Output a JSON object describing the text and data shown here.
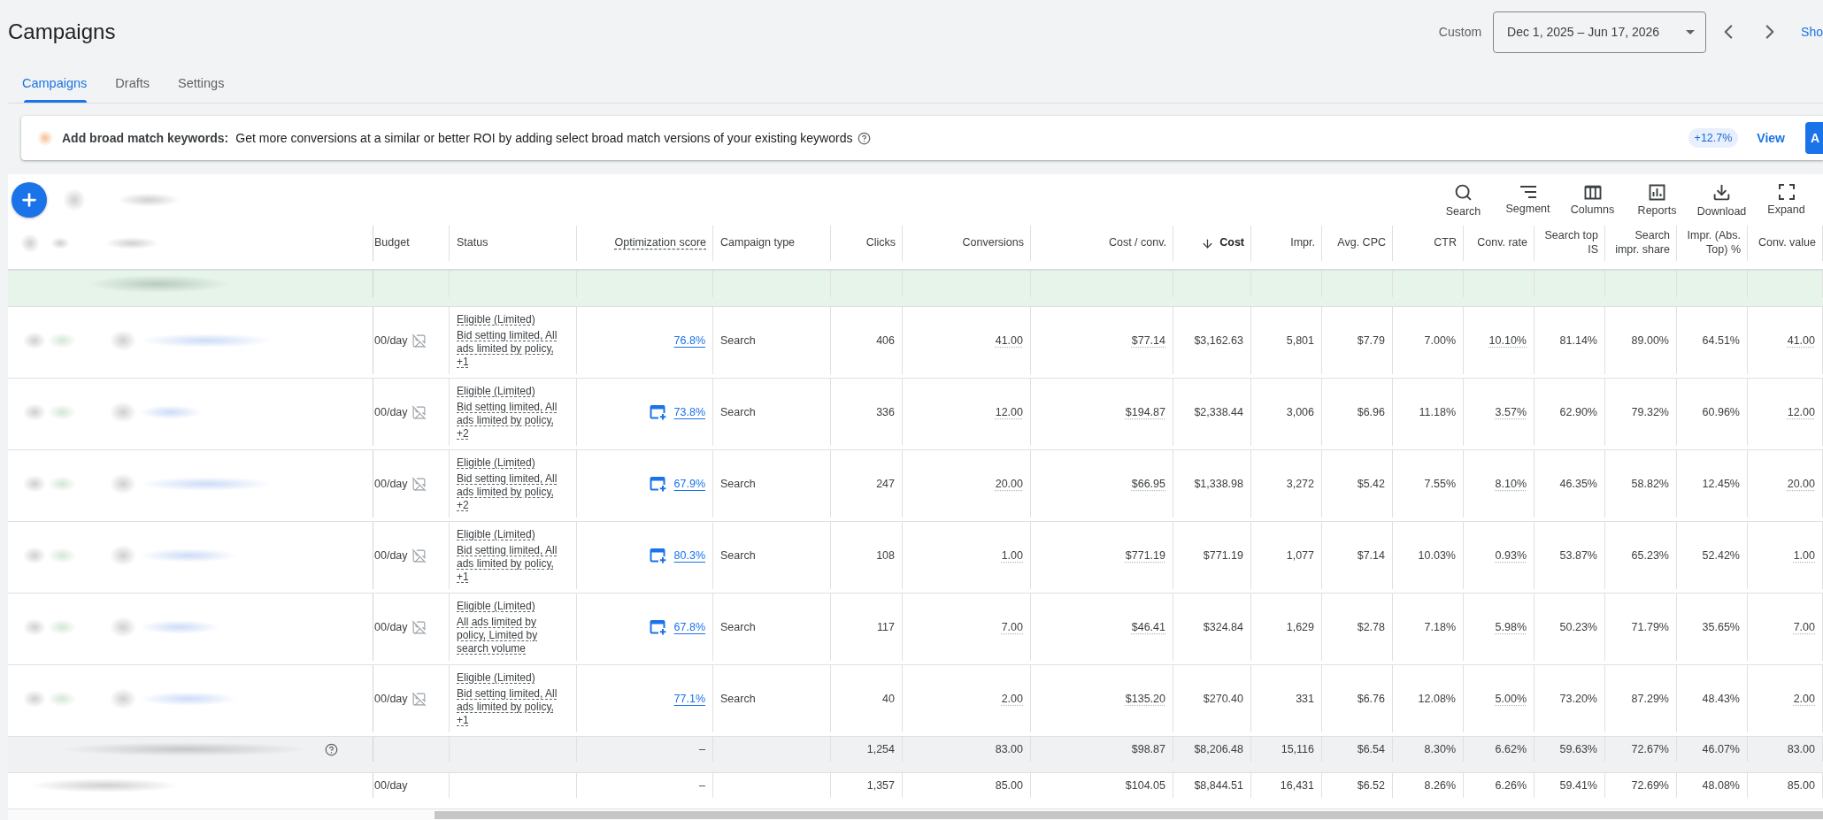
{
  "page": {
    "title": "Campaigns"
  },
  "date_range": {
    "preset": "Custom",
    "range": "Dec 1, 2025 – Jun 17, 2026",
    "show_link": "Sho"
  },
  "tabs": [
    {
      "label": "Campaigns",
      "selected": true
    },
    {
      "label": "Drafts",
      "selected": false
    },
    {
      "label": "Settings",
      "selected": false
    }
  ],
  "banner": {
    "heading": "Add broad match keywords:",
    "message": "Get more conversions at a similar or better ROI by adding select broad match versions of your existing keywords",
    "uplift": "+12.7%",
    "view": "View",
    "apply": "A"
  },
  "toolbar": [
    {
      "label": "Search",
      "kind": "search"
    },
    {
      "label": "Segment",
      "kind": "segment"
    },
    {
      "label": "Columns",
      "kind": "columns"
    },
    {
      "label": "Reports",
      "kind": "reports"
    },
    {
      "label": "Download",
      "kind": "download"
    },
    {
      "label": "Expand",
      "kind": "expand"
    }
  ],
  "table": {
    "columns": [
      {
        "label": "Budget",
        "kind": "budget",
        "sorted": false,
        "underlined": false
      },
      {
        "label": "Status",
        "kind": "status",
        "sorted": false,
        "underlined": false
      },
      {
        "label": "Optimization score",
        "kind": "score",
        "sorted": false,
        "underlined": true
      },
      {
        "label": "Campaign type",
        "kind": "text",
        "sorted": false,
        "underlined": false
      },
      {
        "label": "Clicks",
        "kind": "number",
        "sorted": false,
        "underlined": false,
        "dotted_values": false
      },
      {
        "label": "Conversions",
        "kind": "number",
        "sorted": false,
        "underlined": false,
        "dotted_values": true
      },
      {
        "label": "Cost / conv.",
        "kind": "number",
        "sorted": false,
        "underlined": false,
        "dotted_values": true
      },
      {
        "label": "Cost",
        "kind": "number",
        "sorted": true,
        "underlined": false,
        "dotted_values": false
      },
      {
        "label": "Impr.",
        "kind": "number",
        "sorted": false,
        "underlined": false,
        "dotted_values": false
      },
      {
        "label": "Avg. CPC",
        "kind": "number",
        "sorted": false,
        "underlined": false,
        "dotted_values": false
      },
      {
        "label": "CTR",
        "kind": "number",
        "sorted": false,
        "underlined": false,
        "dotted_values": false
      },
      {
        "label": "Conv. rate",
        "kind": "number",
        "sorted": false,
        "underlined": false,
        "dotted_values": true
      },
      {
        "label": "Search top IS",
        "kind": "number",
        "sorted": false,
        "underlined": false,
        "dotted_values": false
      },
      {
        "label": "Search impr. share",
        "kind": "number",
        "sorted": false,
        "underlined": false,
        "dotted_values": false
      },
      {
        "label": "Impr. (Abs. Top) %",
        "kind": "number",
        "sorted": false,
        "underlined": false,
        "dotted_values": false
      },
      {
        "label": "Conv. value",
        "kind": "number",
        "sorted": false,
        "underlined": false,
        "dotted_values": true
      }
    ],
    "rows": [
      {
        "budget": "00/day",
        "status": "Eligible (Limited)",
        "status_detail": "Bid setting limited, All ads limited by policy, +1",
        "score": "76.8%",
        "score_icon": false,
        "campaign_type": "Search",
        "metrics": [
          "406",
          "41.00",
          "$77.14",
          "$3,162.63",
          "5,801",
          "$7.79",
          "7.00%",
          "10.10%",
          "81.14%",
          "89.00%",
          "64.51%",
          "41.00"
        ]
      },
      {
        "budget": "00/day",
        "status": "Eligible (Limited)",
        "status_detail": "Bid setting limited, All ads limited by policy, +2",
        "score": "73.8%",
        "score_icon": true,
        "campaign_type": "Search",
        "metrics": [
          "336",
          "12.00",
          "$194.87",
          "$2,338.44",
          "3,006",
          "$6.96",
          "11.18%",
          "3.57%",
          "62.90%",
          "79.32%",
          "60.96%",
          "12.00"
        ]
      },
      {
        "budget": "00/day",
        "status": "Eligible (Limited)",
        "status_detail": "Bid setting limited, All ads limited by policy, +2",
        "score": "67.9%",
        "score_icon": true,
        "campaign_type": "Search",
        "metrics": [
          "247",
          "20.00",
          "$66.95",
          "$1,338.98",
          "3,272",
          "$5.42",
          "7.55%",
          "8.10%",
          "46.35%",
          "58.82%",
          "12.45%",
          "20.00"
        ]
      },
      {
        "budget": "00/day",
        "status": "Eligible (Limited)",
        "status_detail": "Bid setting limited, All ads limited by policy, +1",
        "score": "80.3%",
        "score_icon": true,
        "campaign_type": "Search",
        "metrics": [
          "108",
          "1.00",
          "$771.19",
          "$771.19",
          "1,077",
          "$7.14",
          "10.03%",
          "0.93%",
          "53.87%",
          "65.23%",
          "52.42%",
          "1.00"
        ]
      },
      {
        "budget": "00/day",
        "status": "Eligible (Limited)",
        "status_detail": "All ads limited by policy, Limited by search volume",
        "score": "67.8%",
        "score_icon": true,
        "campaign_type": "Search",
        "metrics": [
          "117",
          "7.00",
          "$46.41",
          "$324.84",
          "1,629",
          "$2.78",
          "7.18%",
          "5.98%",
          "50.23%",
          "71.79%",
          "35.65%",
          "7.00"
        ]
      },
      {
        "budget": "00/day",
        "status": "Eligible (Limited)",
        "status_detail": "Bid setting limited, All ads limited by policy, +1",
        "score": "77.1%",
        "score_icon": false,
        "campaign_type": "Search",
        "metrics": [
          "40",
          "2.00",
          "$135.20",
          "$270.40",
          "331",
          "$6.76",
          "12.08%",
          "5.00%",
          "73.20%",
          "87.29%",
          "48.43%",
          "2.00"
        ]
      }
    ],
    "totals": [
      {
        "shaded": true,
        "help_icon": true,
        "score": "–",
        "metrics": [
          "1,254",
          "83.00",
          "$98.87",
          "$8,206.48",
          "15,116",
          "$6.54",
          "8.30%",
          "6.62%",
          "59.63%",
          "72.67%",
          "46.07%",
          "83.00"
        ]
      },
      {
        "shaded": false,
        "help_icon": false,
        "budget": "00/day",
        "score": "–",
        "metrics": [
          "1,357",
          "85.00",
          "$104.05",
          "$8,844.51",
          "16,431",
          "$6.52",
          "8.26%",
          "6.26%",
          "59.41%",
          "72.69%",
          "48.08%",
          "85.00"
        ]
      }
    ]
  }
}
